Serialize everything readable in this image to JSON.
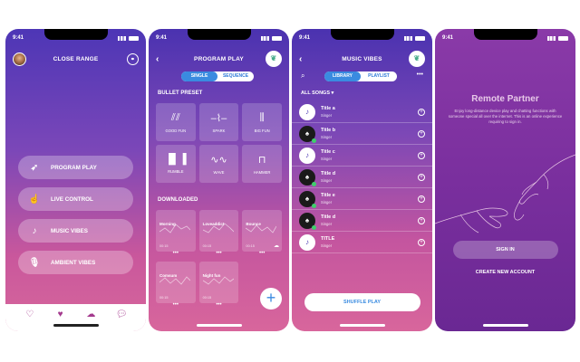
{
  "status_time": "9:41",
  "screen1": {
    "title": "CLOSE RANGE",
    "menu": [
      {
        "label": "PROGRAM PLAY",
        "icon": "rocket-icon"
      },
      {
        "label": "LIVE CONTROL",
        "icon": "hand-icon"
      },
      {
        "label": "MUSIC VIBES",
        "icon": "music-note-icon"
      },
      {
        "label": "AMBIENT VIBES",
        "icon": "microphone-icon"
      }
    ]
  },
  "screen2": {
    "title": "PROGRAM PLAY",
    "seg": [
      "SINGLE",
      "SEQUENCE"
    ],
    "bullet_header": "BULLET PRESET",
    "presets": [
      "GOOD FUN",
      "SPARK",
      "BIG FUN",
      "RUMBLE",
      "WAVE",
      "HAMMER"
    ],
    "downloaded_header": "DOWNLOADED",
    "downloads": [
      {
        "name": "Morning",
        "dur": "00:15"
      },
      {
        "name": "Loveaddict",
        "dur": "00:15"
      },
      {
        "name": "Bounce",
        "dur": "00:15"
      },
      {
        "name": "Comsum",
        "dur": "00:15"
      },
      {
        "name": "Night fun",
        "dur": "00:15"
      }
    ],
    "fab": "+"
  },
  "screen3": {
    "title": "MUSIC VIBES",
    "seg": [
      "LIBRARY",
      "PLAYLIST"
    ],
    "filter": "ALL SONGS",
    "songs": [
      {
        "title": "Title a",
        "artist": "Singer"
      },
      {
        "title": "Title b",
        "artist": "Singer"
      },
      {
        "title": "Title c",
        "artist": "Singer"
      },
      {
        "title": "Title d",
        "artist": "Singer"
      },
      {
        "title": "Title e",
        "artist": "Singer"
      },
      {
        "title": "Title d",
        "artist": "Singer"
      },
      {
        "title": "TITLE",
        "artist": "Singer"
      }
    ],
    "shuffle": "SHUFFLE PLAY"
  },
  "screen4": {
    "title": "Remote Partner",
    "desc": "Enjoy long-distance device play and chatting functions with someone special all over the internet. This is an online experience requiring to sign in.",
    "signin": "SIGN IN",
    "create": "CREATE NEW ACCOUNT"
  }
}
